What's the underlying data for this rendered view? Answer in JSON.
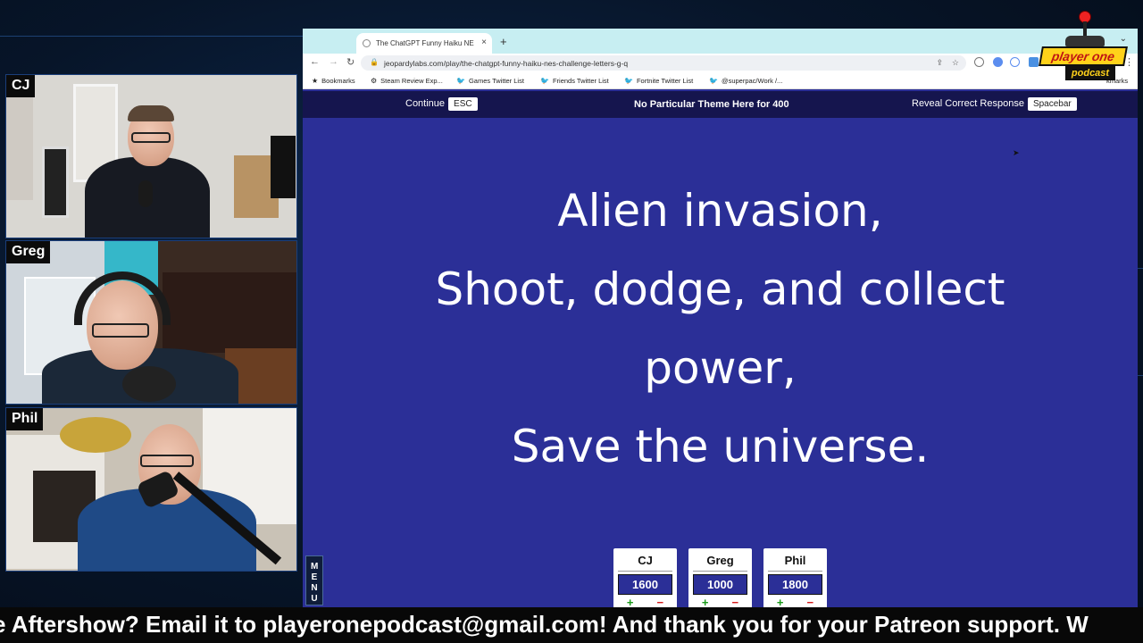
{
  "webcams": [
    {
      "name": "CJ"
    },
    {
      "name": "Greg"
    },
    {
      "name": "Phil"
    }
  ],
  "browser": {
    "tab_title": "The ChatGPT Funny Haiku NE",
    "tab_close": "×",
    "new_tab": "+",
    "url": "jeopardylabs.com/play/the-chatgpt-funny-haiku-nes-challenge-letters-g-q",
    "bookmarks": [
      {
        "label": "Bookmarks"
      },
      {
        "label": "Steam Review Exp..."
      },
      {
        "label": "Games Twitter List"
      },
      {
        "label": "Friends Twitter List"
      },
      {
        "label": "Fortnite Twitter List"
      },
      {
        "label": "@superpac/Work /..."
      }
    ],
    "bookmarks_right": "kmarks"
  },
  "game": {
    "continue_label": "Continue",
    "continue_key": "ESC",
    "category": "No Particular Theme Here for 400",
    "reveal_label": "Reveal Correct Response",
    "reveal_key": "Spacebar",
    "haiku_lines": [
      "Alien invasion,",
      "Shoot, dodge, and collect",
      "power,",
      "Save the universe."
    ],
    "players": [
      {
        "name": "CJ",
        "score": "1600"
      },
      {
        "name": "Greg",
        "score": "1000"
      },
      {
        "name": "Phil",
        "score": "1800"
      }
    ],
    "plus": "+",
    "minus": "−"
  },
  "menu_tab": {
    "label": "MENU"
  },
  "logo": {
    "line1": "player one",
    "line2": "podcast"
  },
  "ticker": "e Aftershow? Email it to playeronepodcast@gmail.com! And thank you for your Patreon support. W"
}
